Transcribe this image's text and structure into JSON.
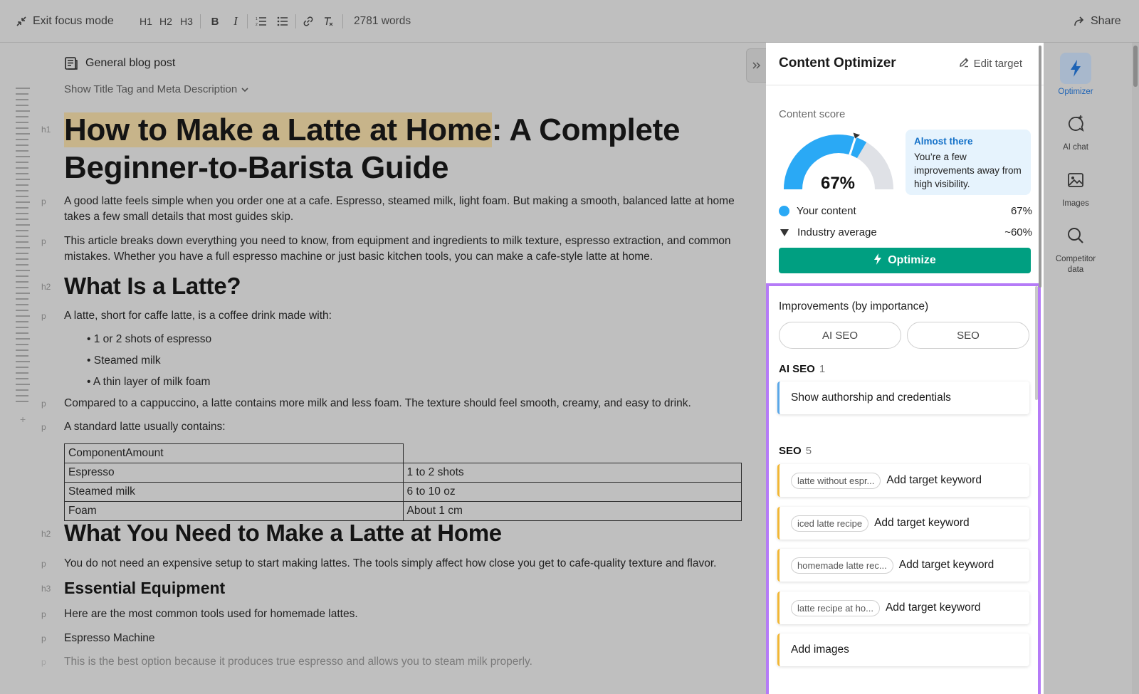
{
  "toolbar": {
    "exit_focus": "Exit focus mode",
    "h1": "H1",
    "h2": "H2",
    "h3": "H3",
    "bold": "B",
    "italic": "I",
    "word_count": "2781 words",
    "share": "Share"
  },
  "editor": {
    "doc_type": "General blog post",
    "meta_toggle": "Show Title Tag and Meta Description",
    "title_highlight": "How to Make a Latte at Home",
    "title_rest": ": A Complete Beginner-to-Barista Guide",
    "tags": {
      "h1": "h1",
      "h2": "h2",
      "h3": "h3",
      "p": "p"
    },
    "p1": "A good latte feels simple when you order one at a cafe. Espresso, steamed milk, light foam. But making a smooth, balanced latte at home takes a few small details that most guides skip.",
    "p2": "This article breaks down everything you need to know, from equipment and ingredients to milk texture, espresso extraction, and common mistakes. Whether you have a full espresso machine or just basic kitchen tools, you can make a cafe-style latte at home.",
    "h2_1": "What Is a Latte?",
    "p3": "A latte, short for caffe latte, is a coffee drink made with:",
    "bullets": [
      "1 or 2 shots of espresso",
      "Steamed milk",
      "A thin layer of milk foam"
    ],
    "p4": "Compared to a cappuccino, a latte contains more milk and less foam. The texture should feel smooth, creamy, and easy to drink.",
    "p5": "A standard latte usually contains:",
    "table": {
      "header": "ComponentAmount",
      "rows": [
        [
          "Espresso",
          "1 to 2 shots"
        ],
        [
          "Steamed milk",
          "6 to 10 oz"
        ],
        [
          "Foam",
          "About 1 cm"
        ]
      ]
    },
    "h2_2": "What You Need to Make a Latte at Home",
    "p6": "You do not need an expensive setup to start making lattes. The tools simply affect how close you get to cafe-quality texture and flavor.",
    "h3_1": "Essential Equipment",
    "p7": "Here are the most common tools used for homemade lattes.",
    "p8": "Espresso Machine",
    "p9": "This is the best option because it produces true espresso and allows you to steam milk properly."
  },
  "optimizer": {
    "title": "Content Optimizer",
    "edit_target": "Edit target",
    "score_label": "Content score",
    "score_value": "67%",
    "score_fraction": 0.67,
    "industry_fraction": 0.6,
    "callout_title": "Almost there",
    "callout_body": "You’re a few improvements away from high visibility.",
    "legend_yours": "Your content",
    "legend_yours_val": "67%",
    "legend_industry": "Industry average",
    "legend_industry_val": "~60%",
    "optimize": "Optimize",
    "improvements_title": "Improvements (by importance)",
    "filter_ai_seo": "AI SEO",
    "filter_seo": "SEO",
    "ai_seo_label": "AI SEO",
    "ai_seo_count": "1",
    "ai_seo_items": [
      "Show authorship and credentials"
    ],
    "seo_label": "SEO",
    "seo_count": "5",
    "seo_items": [
      {
        "keyword": "latte without espr...",
        "action": "Add target keyword"
      },
      {
        "keyword": "iced latte recipe",
        "action": "Add target keyword"
      },
      {
        "keyword": "homemade latte rec...",
        "action": "Add target keyword"
      },
      {
        "keyword": "latte recipe at ho...",
        "action": "Add target keyword"
      }
    ],
    "add_images": "Add images"
  },
  "rail": {
    "optimizer": "Optimizer",
    "ai_chat": "AI chat",
    "images": "Images",
    "competitor": "Competitor data"
  },
  "colors": {
    "score_blue": "#2aa9f5",
    "gauge_track": "#dfe1e6",
    "optimize_green": "#009f81",
    "highlight_border": "#b57bf7",
    "callout_title": "#1471c8"
  }
}
